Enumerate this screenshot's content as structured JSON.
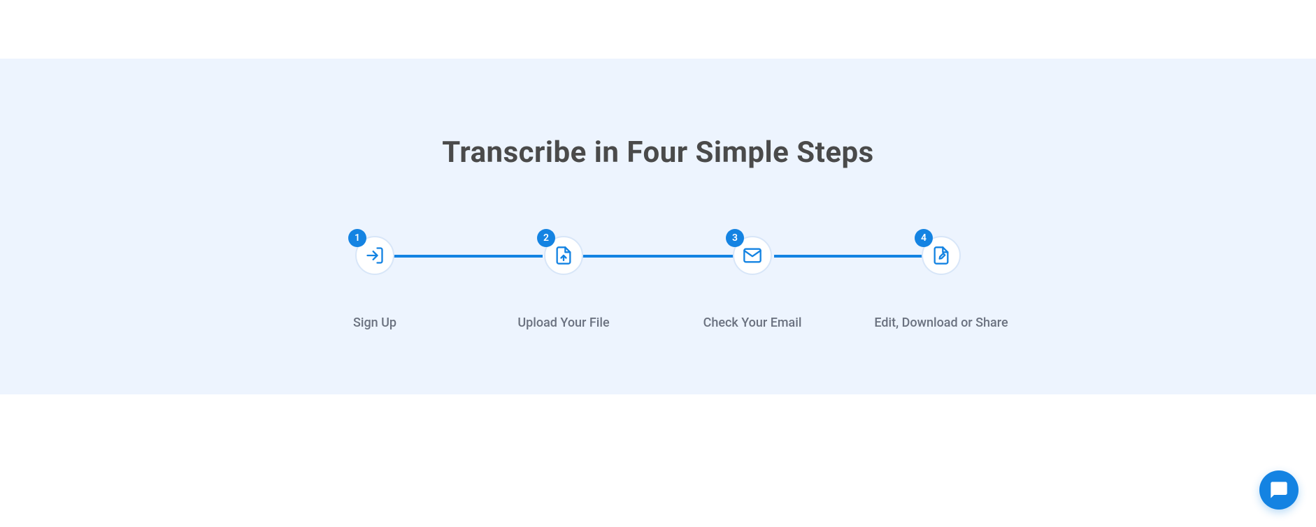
{
  "section": {
    "title": "Transcribe in Four Simple Steps"
  },
  "steps": [
    {
      "number": "1",
      "label": "Sign Up"
    },
    {
      "number": "2",
      "label": "Upload Your File"
    },
    {
      "number": "3",
      "label": "Check Your Email"
    },
    {
      "number": "4",
      "label": "Edit, Download or Share"
    }
  ],
  "colors": {
    "primary": "#1483e2",
    "background": "#edf4fe",
    "text_heading": "#4a4a4a",
    "text_label": "#6b7280"
  }
}
